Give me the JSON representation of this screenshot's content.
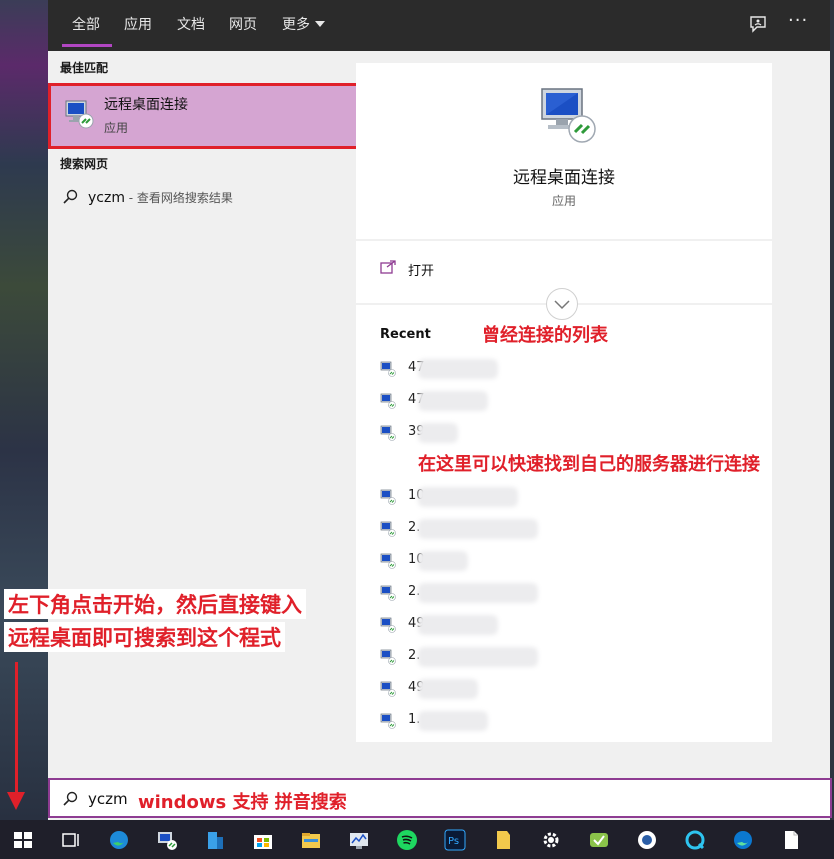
{
  "tabs": {
    "all": "全部",
    "apps": "应用",
    "docs": "文档",
    "web": "网页",
    "more": "更多"
  },
  "topbar": {
    "more_options": "···"
  },
  "results": {
    "best_match_label": "最佳匹配",
    "best_match_title": "远程桌面连接",
    "best_match_type": "应用",
    "web_label": "搜索网页",
    "web_query": "yczm",
    "web_suffix": " - 查看网络搜索结果"
  },
  "preview": {
    "title": "远程桌面连接",
    "type": "应用",
    "open_label": "打开",
    "recent_label": "Recent",
    "recent_items": [
      "47",
      "47",
      "39",
      "",
      "10",
      "2.",
      "10",
      "2.",
      "49",
      "2.",
      "49",
      "1."
    ]
  },
  "search": {
    "value": "yczm"
  },
  "annotations": {
    "recent_list": "曾经连接的列表",
    "quick_find": "在这里可以快速找到自己的服务器进行连接",
    "start_line1": "左下角点击开始，然后直接键入",
    "start_line2": "远程桌面即可搜索到这个程式",
    "pinyin": "windows 支持 拼音搜索"
  },
  "colors": {
    "accent": "#b146c2",
    "highlight": "#d5a5d2",
    "annotation_red": "#e0202a",
    "topbar": "#2b2b2b",
    "taskbar": "#1f1f2a"
  },
  "taskbar_icons": [
    "windows-start-icon",
    "task-view-icon",
    "edge-icon",
    "remote-desktop-icon",
    "building-app-icon",
    "microsoft-store-icon",
    "file-explorer-icon",
    "performance-monitor-icon",
    "spotify-icon",
    "photoshop-icon",
    "folder-note-icon",
    "settings-gear-icon",
    "green-app-icon",
    "chat-app-icon",
    "q-app-icon",
    "edge-beta-icon",
    "document-icon"
  ]
}
